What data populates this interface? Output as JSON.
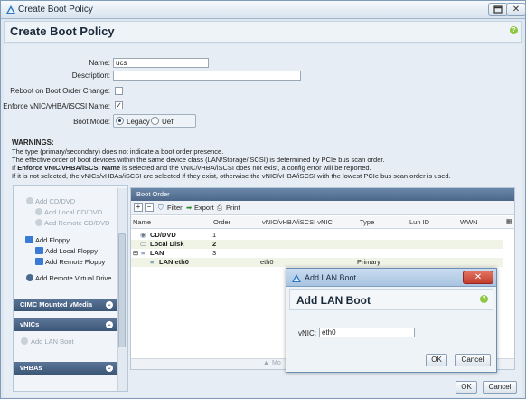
{
  "window": {
    "title": "Create Boot Policy",
    "max_icon": "maximize-icon",
    "close_glyph": "✕"
  },
  "dialog": {
    "title": "Create Boot Policy",
    "help_glyph": "?"
  },
  "form": {
    "name_label": "Name:",
    "name_value": "ucs",
    "description_label": "Description:",
    "description_value": "",
    "reboot_label": "Reboot on Boot Order Change:",
    "reboot_checked": false,
    "enforce_label": "Enforce vNIC/vHBA/iSCSI Name:",
    "enforce_checked": true,
    "check_glyph": "✓",
    "bootmode_label": "Boot Mode:",
    "bootmode_options": [
      "Legacy",
      "Uefi"
    ],
    "bootmode_selected": "Legacy"
  },
  "warnings": {
    "heading": "WARNINGS:",
    "line1": "The type (primary/secondary) does not indicate a boot order presence.",
    "line2": "The effective order of boot devices within the same device class (LAN/Storage/iSCSI) is determined by PCIe bus scan order.",
    "line3_pre": "If ",
    "line3_bold": "Enforce vNIC/vHBA/iSCSI Name",
    "line3_post": " is selected and the vNIC/vHBA/iSCSI does not exist, a config error will be reported.",
    "line4": "If it is not selected, the vNICs/vHBAs/iSCSI are selected if they exist, otherwise the vNIC/vHBA/iSCSI with the lowest PCIe bus scan order is used."
  },
  "left_panel": {
    "items": [
      {
        "label": "Add CD/DVD",
        "enabled": false
      },
      {
        "label": "Add Local CD/DVD",
        "enabled": false
      },
      {
        "label": "Add Remote CD/DVD",
        "enabled": false
      },
      {
        "label": "Add Floppy",
        "enabled": true
      },
      {
        "label": "Add Local Floppy",
        "enabled": true
      },
      {
        "label": "Add Remote Floppy",
        "enabled": true
      },
      {
        "label": "Add Remote Virtual Drive",
        "enabled": true
      }
    ],
    "sections": [
      "CIMC Mounted vMedia",
      "vNICs",
      "vHBAs"
    ],
    "vnic_item": "Add LAN Boot",
    "chevron_glyph": "⌄"
  },
  "boot_order": {
    "title": "Boot Order",
    "toolbar": {
      "add": "+",
      "remove": "−",
      "filter": "Filter",
      "export": "Export",
      "print": "Print"
    },
    "columns": [
      "Name",
      "Order",
      "vNIC/vHBA/iSCSI vNIC",
      "Type",
      "Lun ID",
      "WWN"
    ],
    "rows": [
      {
        "name": "CD/DVD",
        "order": "1",
        "vnic": "",
        "type": ""
      },
      {
        "name": "Local Disk",
        "order": "2",
        "vnic": "",
        "type": ""
      },
      {
        "name": "LAN",
        "order": "3",
        "vnic": "",
        "type": ""
      },
      {
        "name": "LAN eth0",
        "order": "",
        "vnic": "eth0",
        "type": "Primary"
      }
    ],
    "footer_label": "Mo"
  },
  "modal": {
    "window_title": "Add LAN Boot",
    "close_glyph": "✕",
    "title": "Add LAN Boot",
    "vnic_label": "vNIC:",
    "vnic_value": "eth0",
    "ok": "OK",
    "cancel": "Cancel"
  },
  "footer": {
    "ok": "OK",
    "cancel": "Cancel"
  }
}
